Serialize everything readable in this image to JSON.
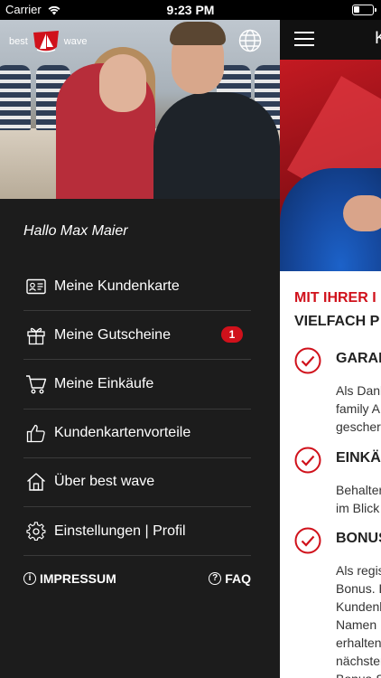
{
  "status_bar": {
    "carrier": "Carrier",
    "time": "9:23 PM"
  },
  "brand": {
    "left": "best",
    "right": "wave"
  },
  "drawer": {
    "greeting": "Hallo Max Maier",
    "items": [
      {
        "label": "Meine Kundenkarte",
        "icon": "id-card-icon"
      },
      {
        "label": "Meine Gutscheine",
        "icon": "gift-icon",
        "badge": "1"
      },
      {
        "label": "Meine Einkäufe",
        "icon": "cart-icon"
      },
      {
        "label": "Kundenkartenvorteile",
        "icon": "thumbs-up-icon"
      },
      {
        "label": "Über best wave",
        "icon": "home-icon"
      },
      {
        "label": "Einstellungen | Profil",
        "icon": "gear-icon"
      }
    ],
    "footer": {
      "impressum": "IMPRESSUM",
      "faq": "FAQ",
      "impressum_icon": "i",
      "faq_icon": "?"
    }
  },
  "main": {
    "title": "K",
    "headline_red": "MIT IHRER I",
    "headline_dark": "VIELFACH P",
    "benefits": [
      {
        "title": "GARAN",
        "lines": [
          "Als Dank",
          "family A",
          "gescher"
        ]
      },
      {
        "title": "EINKÄ",
        "lines": [
          "Behalter",
          "im Blick"
        ]
      },
      {
        "title": "BONUS",
        "lines": [
          "Als regis",
          "Bonus. E",
          "Kundenk",
          "Namen",
          "erhalten",
          "nächster",
          "Bonus-S"
        ]
      }
    ]
  },
  "colors": {
    "accent": "#d0111b",
    "drawer_bg": "#1c1c1c",
    "divider": "#3a3a3a"
  }
}
